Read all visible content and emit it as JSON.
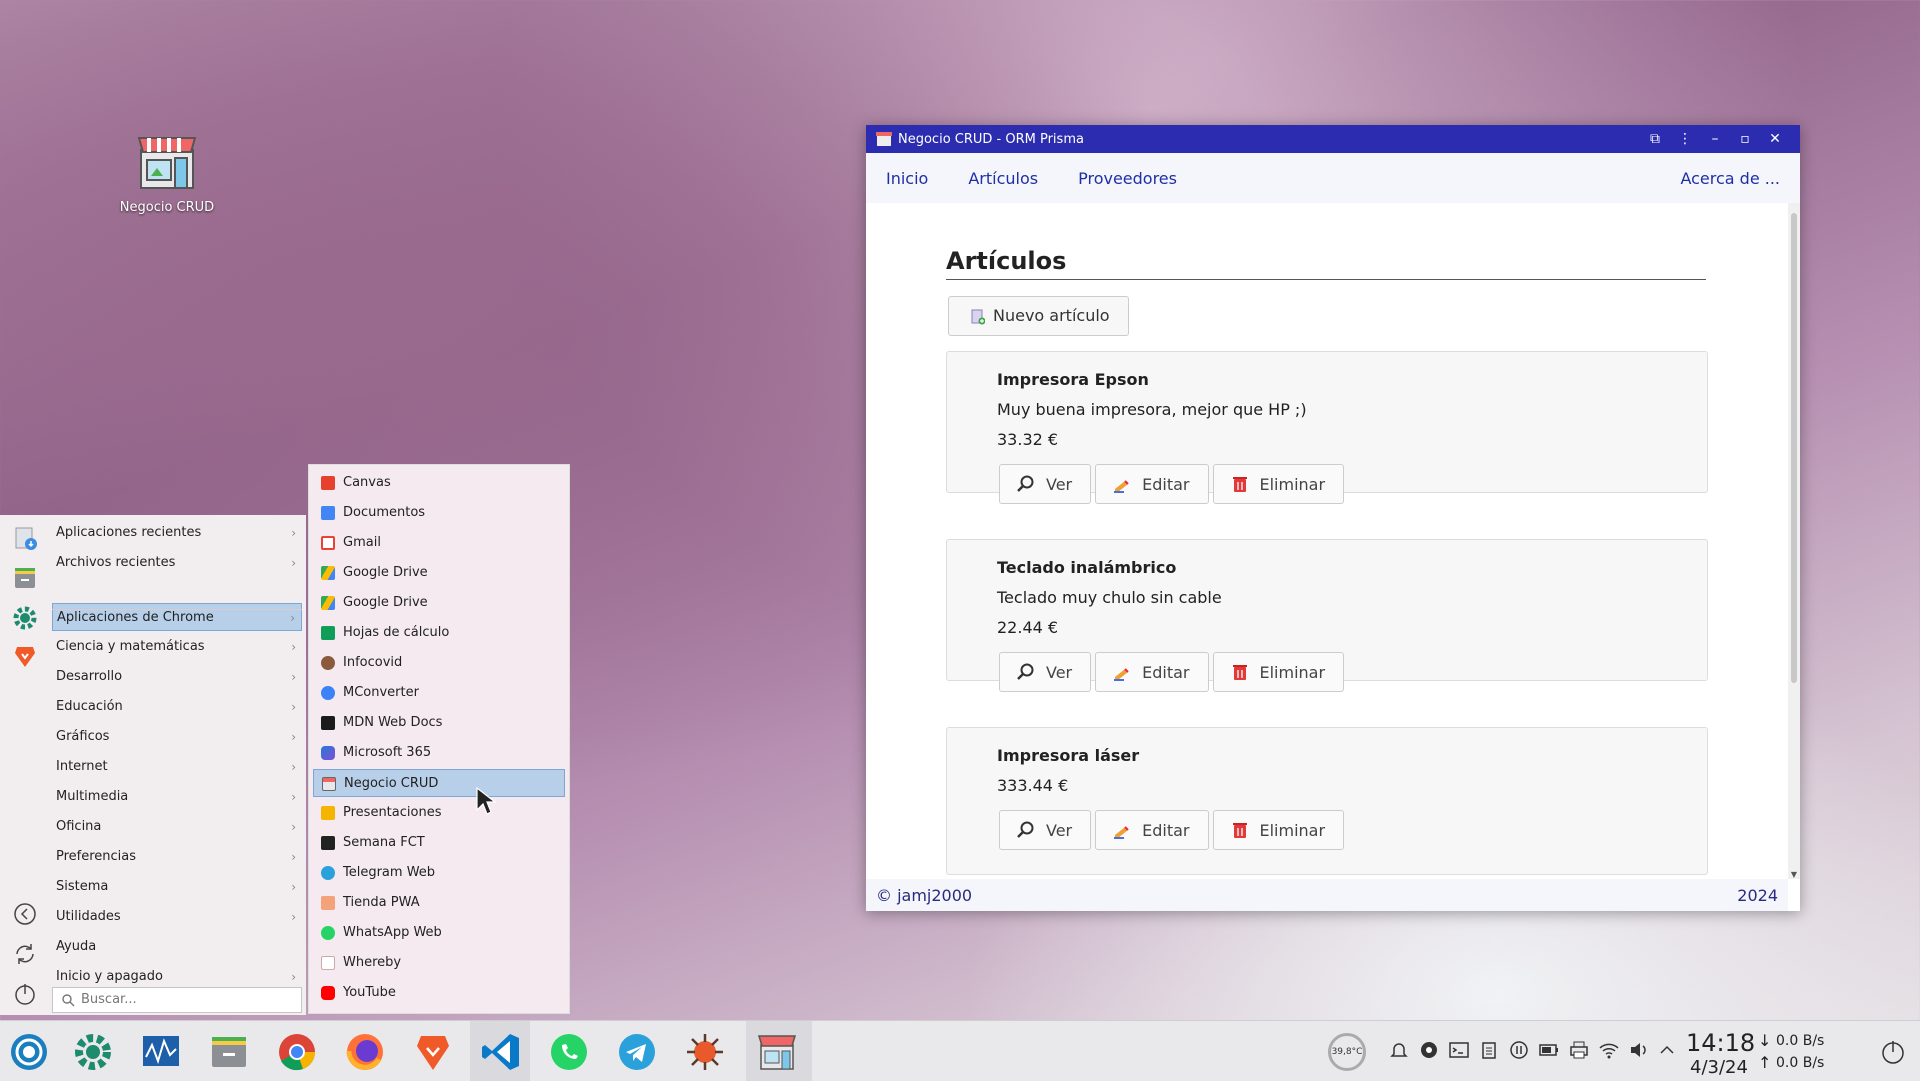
{
  "desktop": {
    "icon_label": "Negocio CRUD"
  },
  "window": {
    "title": "Negocio CRUD - ORM Prisma",
    "nav": {
      "inicio": "Inicio",
      "articulos": "Artículos",
      "proveedores": "Proveedores",
      "about": "Acerca de ..."
    },
    "page_title": "Artículos",
    "new_button": "Nuevo artículo",
    "actions": {
      "view": "Ver",
      "edit": "Editar",
      "delete": "Eliminar"
    },
    "articles": [
      {
        "name": "Impresora Epson",
        "description": "Muy buena impresora, mejor que HP ;)",
        "price": "33.32 €"
      },
      {
        "name": "Teclado inalámbrico",
        "description": "Teclado muy chulo sin cable",
        "price": "22.44 €"
      },
      {
        "name": "Impresora láser",
        "description": "",
        "price": "333.44 €"
      }
    ],
    "footer": {
      "copyright": "© jamj2000",
      "year": "2024"
    }
  },
  "start_menu": {
    "categories": [
      "Aplicaciones recientes",
      "Archivos recientes",
      "Aplicaciones de Chrome",
      "Ciencia y matemáticas",
      "Desarrollo",
      "Educación",
      "Gráficos",
      "Internet",
      "Multimedia",
      "Oficina",
      "Preferencias",
      "Sistema",
      "Utilidades",
      "Ayuda",
      "Inicio y apagado"
    ],
    "selected_category": "Aplicaciones de Chrome",
    "search_placeholder": "Buscar...",
    "chrome_apps": [
      "Canvas",
      "Documentos",
      "Gmail",
      "Google Drive",
      "Google Drive",
      "Hojas de cálculo",
      "Infocovid",
      "MConverter",
      "MDN Web Docs",
      "Microsoft 365",
      "Negocio CRUD",
      "Presentaciones",
      "Semana FCT",
      "Telegram Web",
      "Tienda PWA",
      "WhatsApp Web",
      "Whereby",
      "YouTube"
    ],
    "selected_app": "Negocio CRUD"
  },
  "taskbar": {
    "temperature": "39,8°C",
    "time": "14:18",
    "date": "4/3/24",
    "net_down": "0.0 B/s",
    "net_up": "0.0 B/s"
  },
  "colors": {
    "titlebar": "#2c2cb0",
    "link": "#1f2fa8",
    "selection": "#b7cfe8"
  }
}
